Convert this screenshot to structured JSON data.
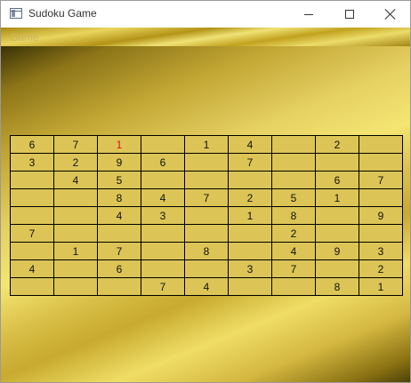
{
  "window": {
    "title": "Sudoku Game",
    "icon": "window-app-icon",
    "controls": [
      "minimize-icon",
      "maximize-icon",
      "close-icon"
    ]
  },
  "menu": {
    "items": [
      {
        "label": "Game"
      }
    ]
  },
  "colors": {
    "cell_fill": "#dcc556",
    "grid_line": "#000000",
    "highlight_digit": "#e01010",
    "normal_digit": "#111111"
  },
  "board": {
    "rows": [
      [
        "6",
        "7",
        "1",
        "",
        "1",
        "4",
        "",
        "2",
        ""
      ],
      [
        "3",
        "2",
        "9",
        "6",
        "",
        "7",
        "",
        "",
        ""
      ],
      [
        "",
        "4",
        "5",
        "",
        "",
        "",
        "",
        "6",
        "7"
      ],
      [
        "",
        "",
        "8",
        "4",
        "7",
        "2",
        "5",
        "1",
        ""
      ],
      [
        "",
        "",
        "4",
        "3",
        "",
        "1",
        "8",
        "",
        "9"
      ],
      [
        "7",
        "",
        "",
        "",
        "",
        "",
        "2",
        "",
        ""
      ],
      [
        "",
        "1",
        "7",
        "",
        "8",
        "",
        "4",
        "9",
        "3"
      ],
      [
        "4",
        "",
        "6",
        "",
        "",
        "3",
        "7",
        "",
        "2"
      ],
      [
        "",
        "",
        "",
        "7",
        "4",
        "",
        "",
        "8",
        "1"
      ]
    ],
    "highlighted": [
      {
        "row": 0,
        "col": 2
      }
    ]
  }
}
